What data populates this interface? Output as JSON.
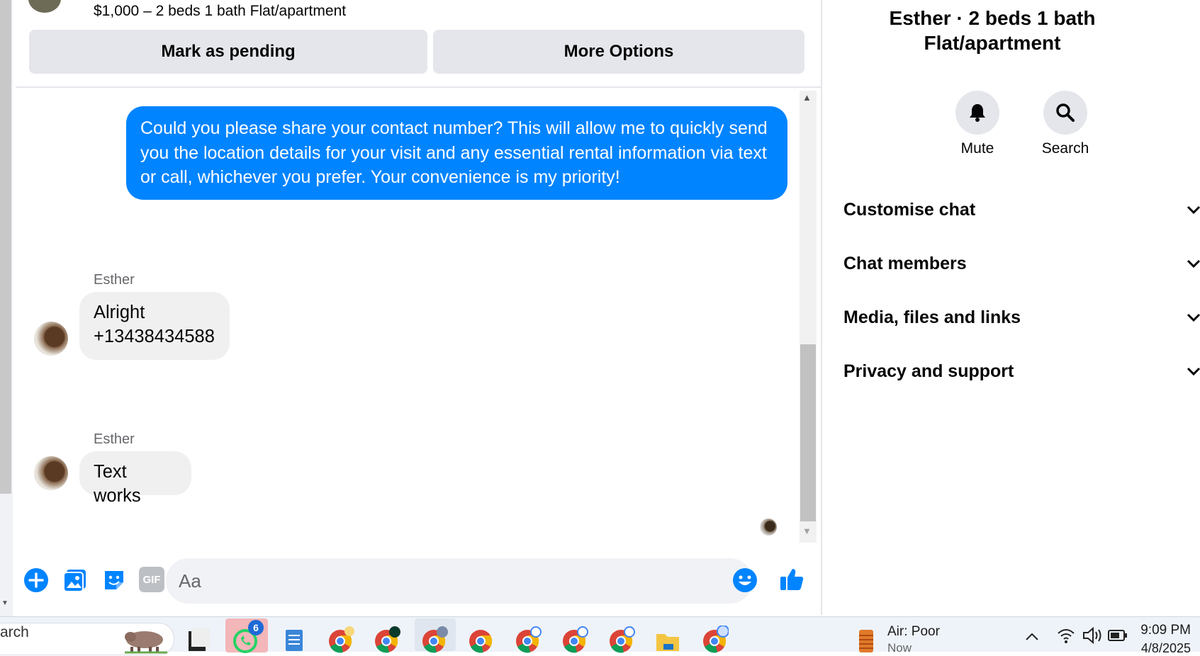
{
  "listing": {
    "title": "$1,000 – 2 beds 1 bath Flat/apartment"
  },
  "actions": {
    "mark_pending": "Mark as pending",
    "more_options": "More Options"
  },
  "messages": {
    "outgoing_1": "Could you please share your contact number? This will allow me to quickly send you the location details for your visit and any essential rental information via text or call, whichever you prefer. Your convenience is my priority!",
    "incoming_1": {
      "sender": "Esther",
      "line1": "Alright",
      "line2": "+13438434588"
    },
    "incoming_2": {
      "sender": "Esther",
      "text": "Text works"
    }
  },
  "composer": {
    "placeholder": "Aa",
    "gif_label": "GIF"
  },
  "details": {
    "title_line1": "Esther · 2 beds 1 bath",
    "title_line2": "Flat/apartment",
    "mute_label": "Mute",
    "search_label": "Search",
    "sections": [
      "Customise chat",
      "Chat members",
      "Media, files and links",
      "Privacy and support"
    ]
  },
  "taskbar": {
    "search_text": "arch",
    "whatsapp_badge": "6",
    "weather_title": "Air: Poor",
    "weather_sub": "Now",
    "time": "9:09 PM",
    "date": "4/8/2025"
  },
  "colors": {
    "accent": "#0084ff",
    "bubble_in": "#f0f0f0",
    "button_bg": "#e4e6eb"
  }
}
